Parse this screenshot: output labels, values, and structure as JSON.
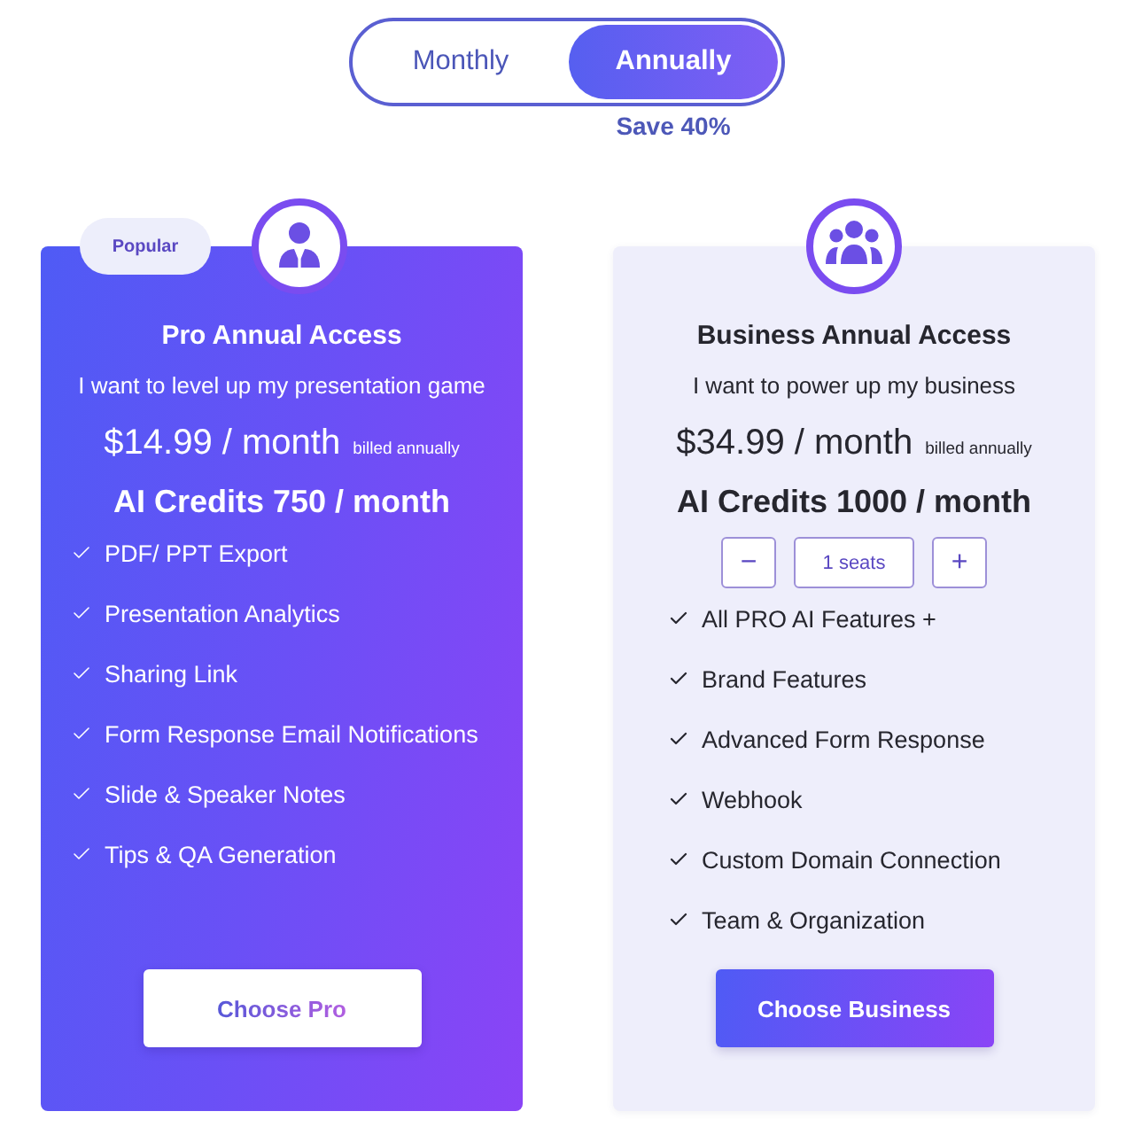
{
  "billing_toggle": {
    "options": [
      {
        "label": "Monthly",
        "selected": false
      },
      {
        "label": "Annually",
        "selected": true
      }
    ],
    "note": "Save 40%"
  },
  "plans": [
    {
      "kind": "individual",
      "featured": true,
      "badge": "Popular",
      "title": "Pro Annual Access",
      "subtitle": "I want to level up my presentation game",
      "price": "$14.99 / month",
      "price_note": "billed annually",
      "credits": "AI Credits 750 / month",
      "features": [
        "PDF/ PPT Export",
        "Presentation Analytics",
        "Sharing Link",
        "Form Response Email Notifications",
        "Slide & Speaker Notes",
        "Tips & QA Generation"
      ],
      "button": "Choose Pro"
    },
    {
      "kind": "team",
      "featured": false,
      "title": "Business Annual Access",
      "subtitle": "I want to power up my business",
      "price": "$34.99 / month",
      "price_note": "billed annually",
      "credits": "AI Credits 1000 / month",
      "seats": {
        "decrement": "−",
        "value": "1 seats",
        "increment": "+"
      },
      "features": [
        "All PRO AI Features +",
        "Brand Features",
        "Advanced Form Response",
        "Webhook",
        "Custom Domain Connection",
        "Team & Organization"
      ],
      "button": "Choose Business"
    }
  ]
}
